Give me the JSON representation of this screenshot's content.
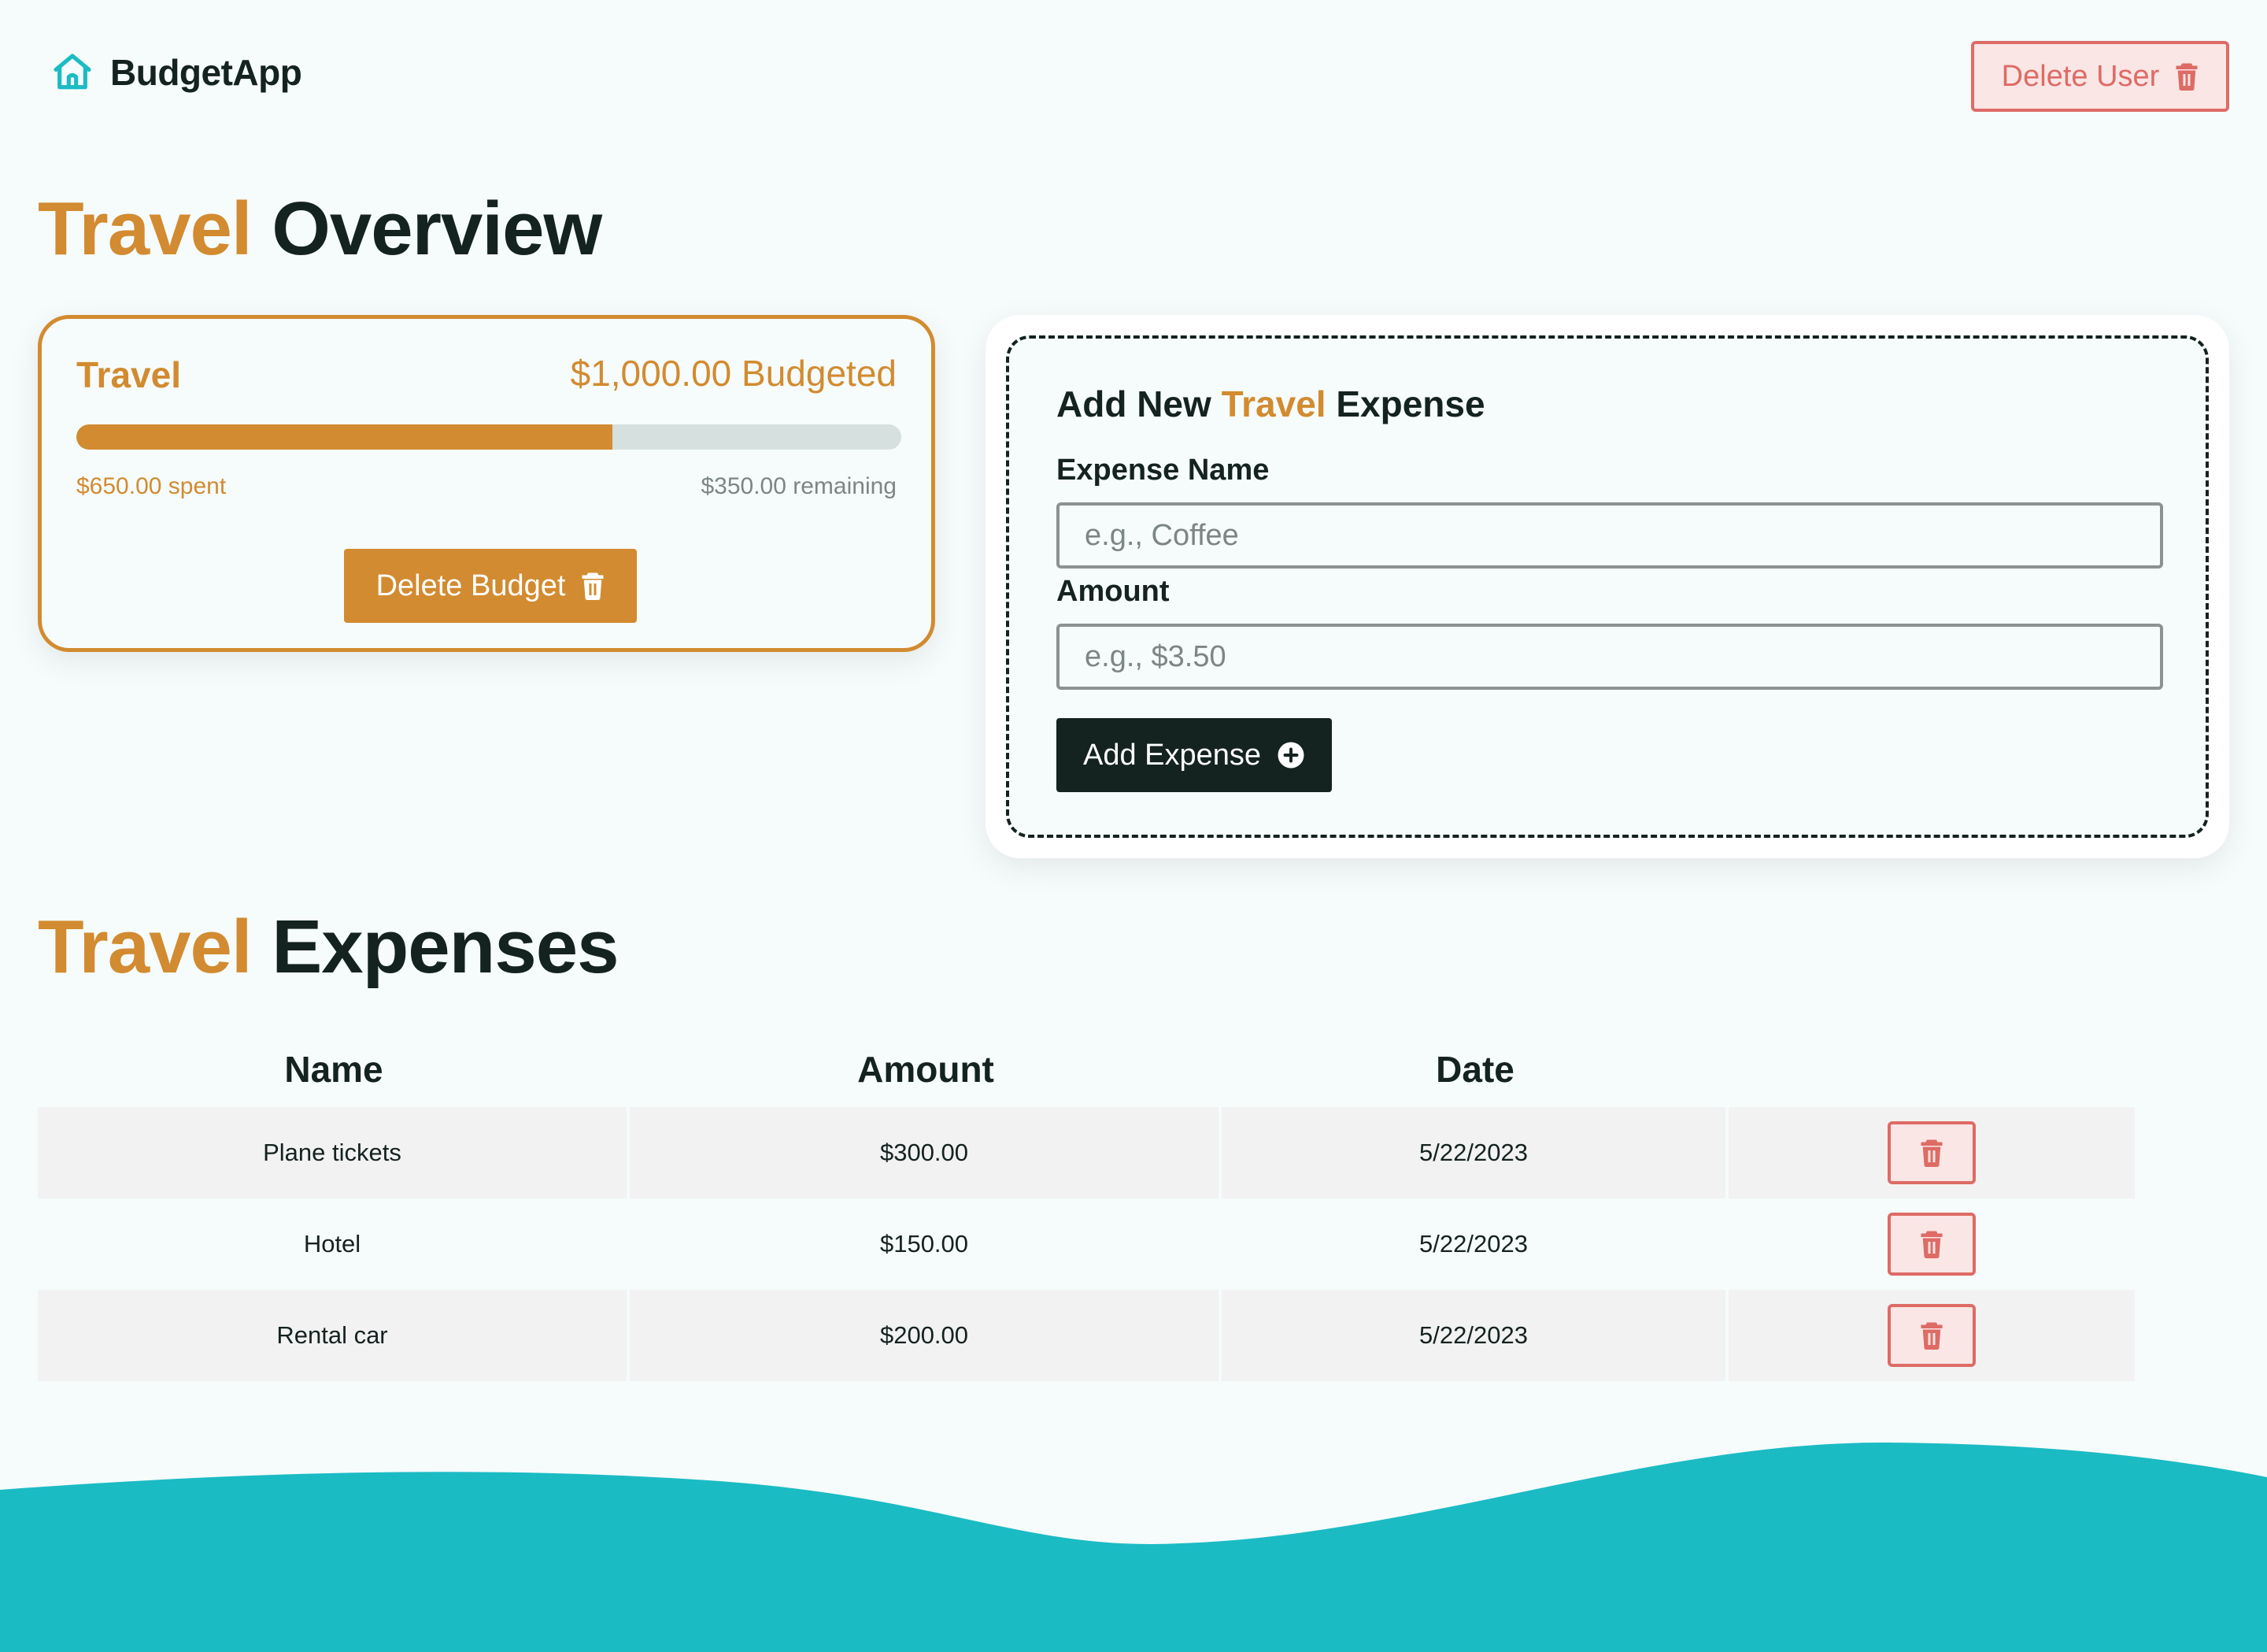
{
  "app": {
    "brand": "BudgetApp",
    "delete_user_label": "Delete User"
  },
  "overview": {
    "title_accent": "Travel",
    "title_rest": " Overview"
  },
  "budget": {
    "name": "Travel",
    "budgeted": "$1,000.00 Budgeted",
    "spent": "$650.00 spent",
    "remaining": "$350.00 remaining",
    "progress_percent": 65,
    "delete_label": "Delete Budget"
  },
  "add_expense": {
    "title_prefix": "Add New ",
    "title_accent": "Travel",
    "title_suffix": " Expense",
    "name_label": "Expense Name",
    "name_placeholder": "e.g., Coffee",
    "amount_label": "Amount",
    "amount_placeholder": "e.g., $3.50",
    "submit_label": "Add Expense"
  },
  "expenses": {
    "title_accent": "Travel",
    "title_rest": " Expenses",
    "columns": [
      "Name",
      "Amount",
      "Date"
    ],
    "rows": [
      {
        "name": "Plane tickets",
        "amount": "$300.00",
        "date": "5/22/2023"
      },
      {
        "name": "Hotel",
        "amount": "$150.00",
        "date": "5/22/2023"
      },
      {
        "name": "Rental car",
        "amount": "$200.00",
        "date": "5/22/2023"
      }
    ]
  },
  "colors": {
    "accent": "#d28b30",
    "danger": "#de6b65",
    "dark": "#142220",
    "wave": "#1bbbc4"
  }
}
